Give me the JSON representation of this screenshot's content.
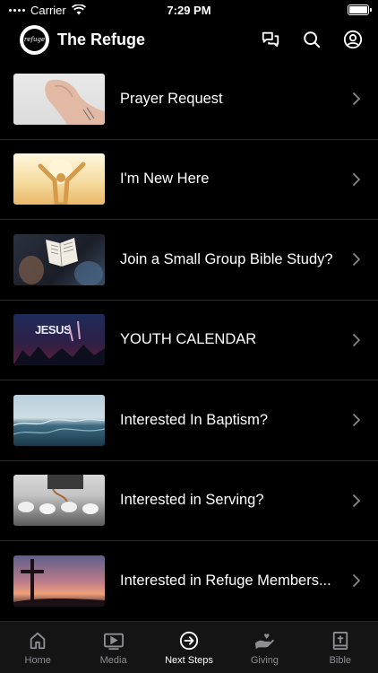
{
  "status_bar": {
    "carrier": "Carrier",
    "time": "7:29 PM"
  },
  "header": {
    "logo_text": "refuge",
    "title": "The Refuge",
    "actions": [
      {
        "icon": "chat-icon"
      },
      {
        "icon": "search-icon"
      },
      {
        "icon": "profile-icon"
      }
    ]
  },
  "list": {
    "items": [
      {
        "label": "Prayer Request",
        "thumb": "folded-hands"
      },
      {
        "label": "I'm New Here",
        "thumb": "raised-arms-sunlight"
      },
      {
        "label": "Join a Small Group Bible Study?",
        "thumb": "open-bible"
      },
      {
        "label": "YOUTH CALENDAR",
        "thumb": "jesus-concert",
        "thumb_text": "JESUS"
      },
      {
        "label": "Interested In Baptism?",
        "thumb": "ocean-waves"
      },
      {
        "label": "Interested in Serving?",
        "thumb": "coffee-cups"
      },
      {
        "label": "Interested in Refuge Members...",
        "thumb": "cross-sunset"
      }
    ]
  },
  "tabs": [
    {
      "label": "Home",
      "icon": "home-icon",
      "active": false
    },
    {
      "label": "Media",
      "icon": "media-icon",
      "active": false
    },
    {
      "label": "Next Steps",
      "icon": "next-steps-icon",
      "active": true
    },
    {
      "label": "Giving",
      "icon": "giving-icon",
      "active": false
    },
    {
      "label": "Bible",
      "icon": "bible-icon",
      "active": false
    }
  ],
  "colors": {
    "background": "#000000",
    "text": "#ffffff",
    "inactive_tab": "#8e8e93",
    "divider": "#2a2a2a"
  }
}
